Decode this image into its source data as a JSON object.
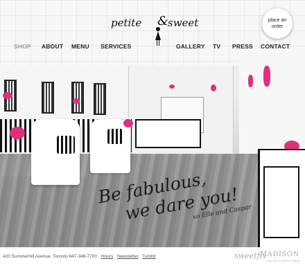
{
  "logo": {
    "text_left": "petite",
    "text_right": "sweet"
  },
  "place_order": {
    "label": "place an order"
  },
  "nav": {
    "items": [
      {
        "label": "SHOP",
        "active": true
      },
      {
        "label": "ABOUT"
      },
      {
        "label": "MENU"
      },
      {
        "label": "SERVICES"
      },
      {
        "label": "GALLERY"
      },
      {
        "label": "TV"
      },
      {
        "label": "PRESS"
      },
      {
        "label": "CONTACT"
      }
    ]
  },
  "hero": {
    "line1": "Be fabulous,",
    "line2": "we dare you!",
    "signature": "xo Elle and Caspar"
  },
  "footer": {
    "address": "420 Summerhill Avenue, Toronto 647-348-7700",
    "links": [
      "Hours",
      "Newsletter",
      "Tumblr"
    ],
    "partner1": "sweetfix",
    "partner2": "MADISON",
    "partner2_sub": "SALON & BOUTIQUE"
  },
  "colors": {
    "accent_pink": "#e0307a",
    "text": "#222222"
  }
}
